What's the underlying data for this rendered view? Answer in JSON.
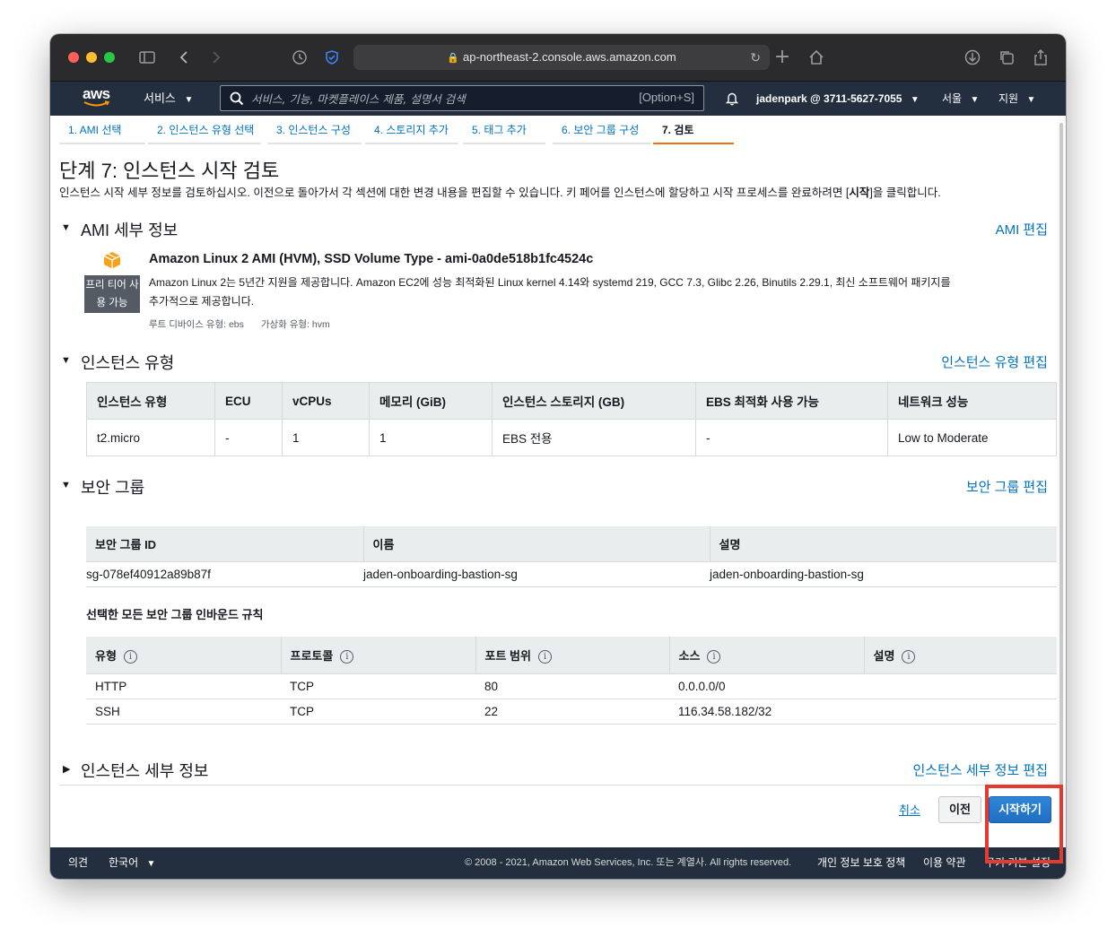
{
  "browser": {
    "url": "ap-northeast-2.console.aws.amazon.com"
  },
  "nav": {
    "logo": "aws",
    "services": "서비스",
    "search_placeholder": "서비스, 기능, 마켓플레이스 제품, 설명서 검색",
    "search_shortcut": "[Option+S]",
    "account": "jadenpark @ 3711-5627-7055",
    "region": "서울",
    "support": "지원"
  },
  "steps": [
    {
      "label": "1. AMI 선택"
    },
    {
      "label": "2. 인스턴스 유형 선택"
    },
    {
      "label": "3. 인스턴스 구성"
    },
    {
      "label": "4. 스토리지 추가"
    },
    {
      "label": "5. 태그 추가"
    },
    {
      "label": "6. 보안 그룹 구성"
    },
    {
      "label": "7. 검토"
    }
  ],
  "page": {
    "title": "단계 7: 인스턴스 시작 검토",
    "subtitle_pre": "인스턴스 시작 세부 정보를 검토하십시오. 이전으로 돌아가서 각 섹션에 대한 변경 내용을 편집할 수 있습니다. 키 페어를 인스턴스에 할당하고 시작 프로세스를 완료하려면 [",
    "subtitle_bold": "시작",
    "subtitle_post": "]을 클릭합니다."
  },
  "ami": {
    "section_title": "AMI 세부 정보",
    "edit_label": "AMI 편집",
    "free_tier": "프리 티어 사용 가능",
    "name": "Amazon Linux 2 AMI (HVM), SSD Volume Type - ami-0a0de518b1fc4524c",
    "description": "Amazon Linux 2는 5년간 지원을 제공합니다. Amazon EC2에 성능 최적화된 Linux kernel 4.14와 systemd 219, GCC 7.3, Glibc 2.26, Binutils 2.29.1, 최신 소프트웨어 패키지를 추가적으로 제공합니다.",
    "root_device": "루트 디바이스 유형: ebs",
    "virtualization": "가상화 유형: hvm"
  },
  "instance_type": {
    "section_title": "인스턴스 유형",
    "edit_label": "인스턴스 유형 편집",
    "headers": [
      "인스턴스 유형",
      "ECU",
      "vCPUs",
      "메모리 (GiB)",
      "인스턴스 스토리지 (GB)",
      "EBS 최적화 사용 가능",
      "네트워크 성능"
    ],
    "row": [
      "t2.micro",
      "-",
      "1",
      "1",
      "EBS 전용",
      "-",
      "Low to Moderate"
    ]
  },
  "security_group": {
    "section_title": "보안 그룹",
    "edit_label": "보안 그룹 편집",
    "headers": [
      "보안 그룹 ID",
      "이름",
      "설명"
    ],
    "row": [
      "sg-078ef40912a89b87f",
      "jaden-onboarding-bastion-sg",
      "jaden-onboarding-bastion-sg"
    ],
    "inbound_title": "선택한 모든 보안 그룹 인바운드 규칙",
    "rule_headers": [
      "유형",
      "프로토콜",
      "포트 범위",
      "소스",
      "설명"
    ],
    "rules": [
      [
        "HTTP",
        "TCP",
        "80",
        "0.0.0.0/0",
        ""
      ],
      [
        "SSH",
        "TCP",
        "22",
        "116.34.58.182/32",
        ""
      ]
    ]
  },
  "instance_details": {
    "section_title": "인스턴스 세부 정보",
    "edit_label": "인스턴스 세부 정보 편집"
  },
  "actions": {
    "cancel": "취소",
    "previous": "이전",
    "launch": "시작하기"
  },
  "footer": {
    "feedback": "의견",
    "language": "한국어",
    "copyright": "© 2008 - 2021, Amazon Web Services, Inc. 또는 계열사. All rights reserved.",
    "privacy": "개인 정보 보호 정책",
    "terms": "이용 약관",
    "cookies": "쿠키 기본 설정"
  },
  "colors": {
    "aws_nav": "#232f3e",
    "link": "#0073bb",
    "primary_button": "#1f6fc1",
    "active_step": "#ec7211",
    "highlight": "#e53a2f"
  }
}
